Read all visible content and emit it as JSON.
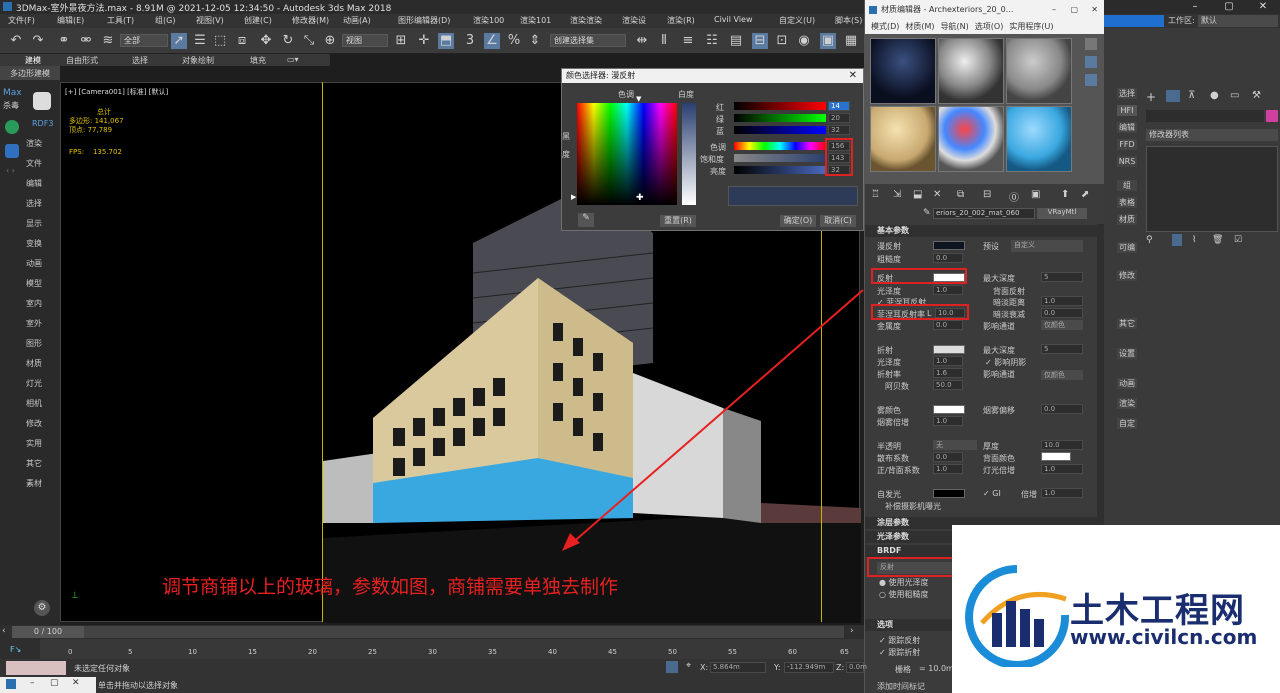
{
  "window": {
    "title": "3DMax-室外景夜方法.max - 8.91M @ 2021-12-05 12:34:50 - Autodesk 3ds Max 2018",
    "workspace_label": "工作区:",
    "workspace_value": "默认"
  },
  "menu": [
    "文件(F)",
    "编辑(E)",
    "工具(T)",
    "组(G)",
    "视图(V)",
    "创建(C)",
    "修改器(M)",
    "动画(A)",
    "图形编辑器(D)",
    "渲染100",
    "渲染101",
    "渲染渲染",
    "渲染设",
    "渲染(R)",
    "Civil View",
    "自定义(U)",
    "脚本(S)"
  ],
  "toolbar": {
    "filter": "全部",
    "view": "视图",
    "selection_set": "创建选择集"
  },
  "ribbon": {
    "tabs": [
      "建模",
      "自由形式",
      "选择",
      "对象绘制",
      "填充"
    ],
    "sub": "多边形建模"
  },
  "left_panel": {
    "brand": "Max",
    "brand2": "杀毒",
    "rdf": "RDF3",
    "items": [
      "渲染",
      "文件",
      "编辑",
      "选择",
      "显示",
      "变换",
      "动画",
      "模型",
      "室内",
      "室外",
      "图形",
      "材质",
      "灯光",
      "相机",
      "修改",
      "实用",
      "其它",
      "素材"
    ]
  },
  "viewport": {
    "label": "[+] [Camera001] [标准] [默认]",
    "stats": {
      "total": "总计",
      "polys_label": "多边形:",
      "polys": "141,067",
      "verts_label": "顶点:",
      "verts": "77,789",
      "fps_label": "FPS:",
      "fps": "135.702"
    }
  },
  "color_dialog": {
    "title": "颜色选择器: 漫反射",
    "hue_label": "色调",
    "white_label": "白度",
    "black_label": "黑",
    "sat_label": "度",
    "red": "红",
    "red_val": "14",
    "green": "绿",
    "green_val": "20",
    "blue": "蓝",
    "blue_val": "32",
    "hue": "色调",
    "hue_val": "156",
    "sat": "饱和度",
    "sat_val": "143",
    "val": "亮度",
    "val_val": "32",
    "reset": "重置(R)",
    "ok": "确定(O)",
    "cancel": "取消(C)"
  },
  "material_editor": {
    "title": "材质编辑器 - Archexteriors_20_0...",
    "menu": [
      "模式(D)",
      "材质(M)",
      "导航(N)",
      "选项(O)",
      "实用程序(U)"
    ],
    "mat_name": "eriors_20_002_mat_060",
    "mat_type": "VRayMtl",
    "basic": "基本参数",
    "diffuse": "漫反射",
    "roughness": "粗糙度",
    "roughness_val": "0.0",
    "preset": "预设",
    "preset_val": "自定义",
    "reflect": "反射",
    "max_depth": "最大深度",
    "max_depth_val": "5",
    "gloss": "光泽度",
    "gloss_val": "1.0",
    "back_reflect": "背面反射",
    "fresnel": "菲涅耳反射",
    "dim_dist": "暗淡距离",
    "dim_dist_val": "1.0",
    "fresnel_ior": "菲涅耳反射率",
    "fresnel_ior_l": "L",
    "fresnel_ior_val": "10.0",
    "dim_falloff": "暗淡衰减",
    "dim_falloff_val": "0.0",
    "metal": "金属度",
    "metal_val": "0.0",
    "affect_ch": "影响通道",
    "affect_ch_val": "仅颜色",
    "refract": "折射",
    "refract_depth": "最大深度",
    "refract_depth_val": "5",
    "refract_gloss": "光泽度",
    "refract_gloss_val": "1.0",
    "affect_shadow": "影响阴影",
    "ior": "折射率",
    "ior_val": "1.6",
    "affect_ch2": "影响通道",
    "affect_ch2_val": "仅颜色",
    "abbe": "阿贝数",
    "abbe_val": "50.0",
    "fog": "雾颜色",
    "fog_bias": "烟雾偏移",
    "fog_bias_val": "0.0",
    "fog_mult": "烟雾倍增",
    "fog_mult_val": "1.0",
    "translucency": "半透明",
    "translucency_val": "无",
    "thickness": "厚度",
    "thickness_val": "10.0",
    "scatter": "散布系数",
    "scatter_val": "0.0",
    "back_color": "背面颜色",
    "fb": "正/背面系数",
    "fb_val": "1.0",
    "light_mult": "灯光倍增",
    "light_mult_val": "1.0",
    "selfillum": "自发光",
    "gi": "GI",
    "mult": "倍增",
    "mult_val": "1.0",
    "comp": "补偿摄影机曝光",
    "coat": "涂层参数",
    "sheen": "光泽参数",
    "brdf": "BRDF",
    "brdf_val": "反射",
    "use_gloss": "使用光泽度",
    "use_rough": "使用粗糙度",
    "options": "选项",
    "trace_refl": "跟踪反射",
    "trace_refr": "跟踪折射"
  },
  "command_panel": {
    "modifier_list": "修改器列表",
    "side_labels": [
      "选择",
      "HFI",
      "编辑",
      "FFD",
      "NRS",
      "组",
      "表格",
      "材质",
      "可编",
      "修改",
      "其它",
      "设置",
      "动画",
      "渲染",
      "自定"
    ]
  },
  "timeline": {
    "frame": "0 / 100",
    "ticks": [
      "0",
      "5",
      "10",
      "15",
      "20",
      "25",
      "30",
      "35",
      "40",
      "45",
      "50",
      "55",
      "60",
      "65",
      "70"
    ]
  },
  "status": {
    "no_selection": "未选定任何对象",
    "hint": "单击并拖动以选择对象",
    "x_label": "X:",
    "x_val": "5.864m",
    "y_label": "Y:",
    "y_val": "-112.949m",
    "z_label": "Z:",
    "z_val": "0.0m",
    "grid_label": "栅格",
    "grid_val": "= 10.0m",
    "add_tag": "添加时间标记"
  },
  "annotation": "调节商铺以上的玻璃，参数如图，商铺需要单独去制作",
  "watermark": {
    "name": "土木工程网",
    "url": "www.civilcn.com"
  }
}
